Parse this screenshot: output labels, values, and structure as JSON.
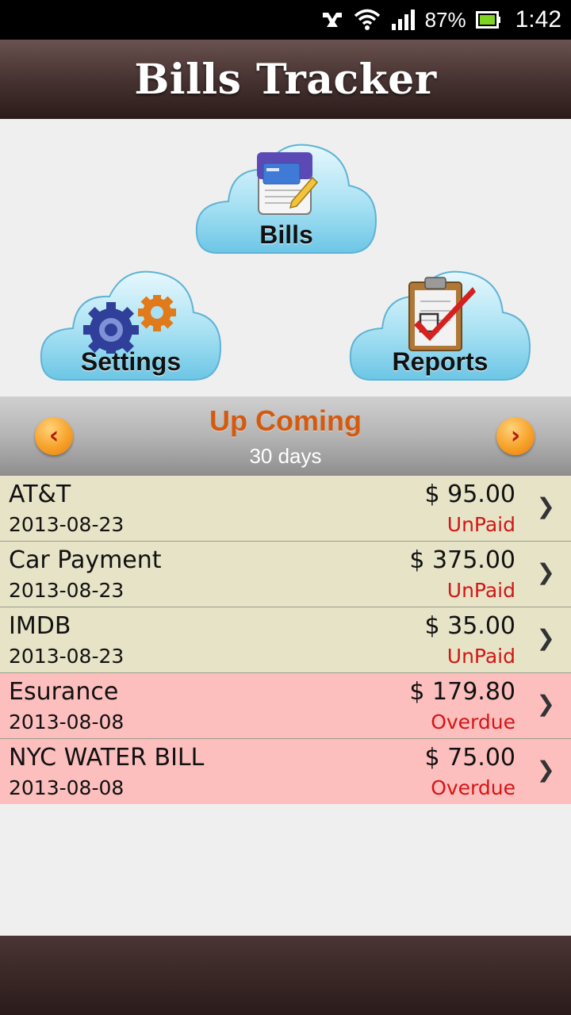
{
  "status_bar": {
    "battery_percent": "87%",
    "time": "1:42",
    "icons": [
      "usb-icon",
      "wifi-icon",
      "signal-icon",
      "battery-icon"
    ]
  },
  "app": {
    "title": "Bills Tracker"
  },
  "nav": {
    "bills_label": "Bills",
    "settings_label": "Settings",
    "reports_label": "Reports"
  },
  "upcoming": {
    "title": "Up Coming",
    "subtitle": "30 days",
    "prev_icon": "chevron-left-icon",
    "next_icon": "chevron-right-icon"
  },
  "colors": {
    "unpaid_row_bg": "#e6e3c7",
    "overdue_row_bg": "#fdbebe",
    "status_text": "#d41515",
    "accent_orange": "#d45a10"
  },
  "bills": [
    {
      "name": "AT&T",
      "amount": "$ 95.00",
      "date": "2013-08-23",
      "status": "UnPaid"
    },
    {
      "name": "Car Payment",
      "amount": "$ 375.00",
      "date": "2013-08-23",
      "status": "UnPaid"
    },
    {
      "name": "IMDB",
      "amount": "$ 35.00",
      "date": "2013-08-23",
      "status": "UnPaid"
    },
    {
      "name": "Esurance",
      "amount": "$ 179.80",
      "date": "2013-08-08",
      "status": "Overdue"
    },
    {
      "name": "NYC WATER BILL",
      "amount": "$ 75.00",
      "date": "2013-08-08",
      "status": "Overdue"
    }
  ]
}
